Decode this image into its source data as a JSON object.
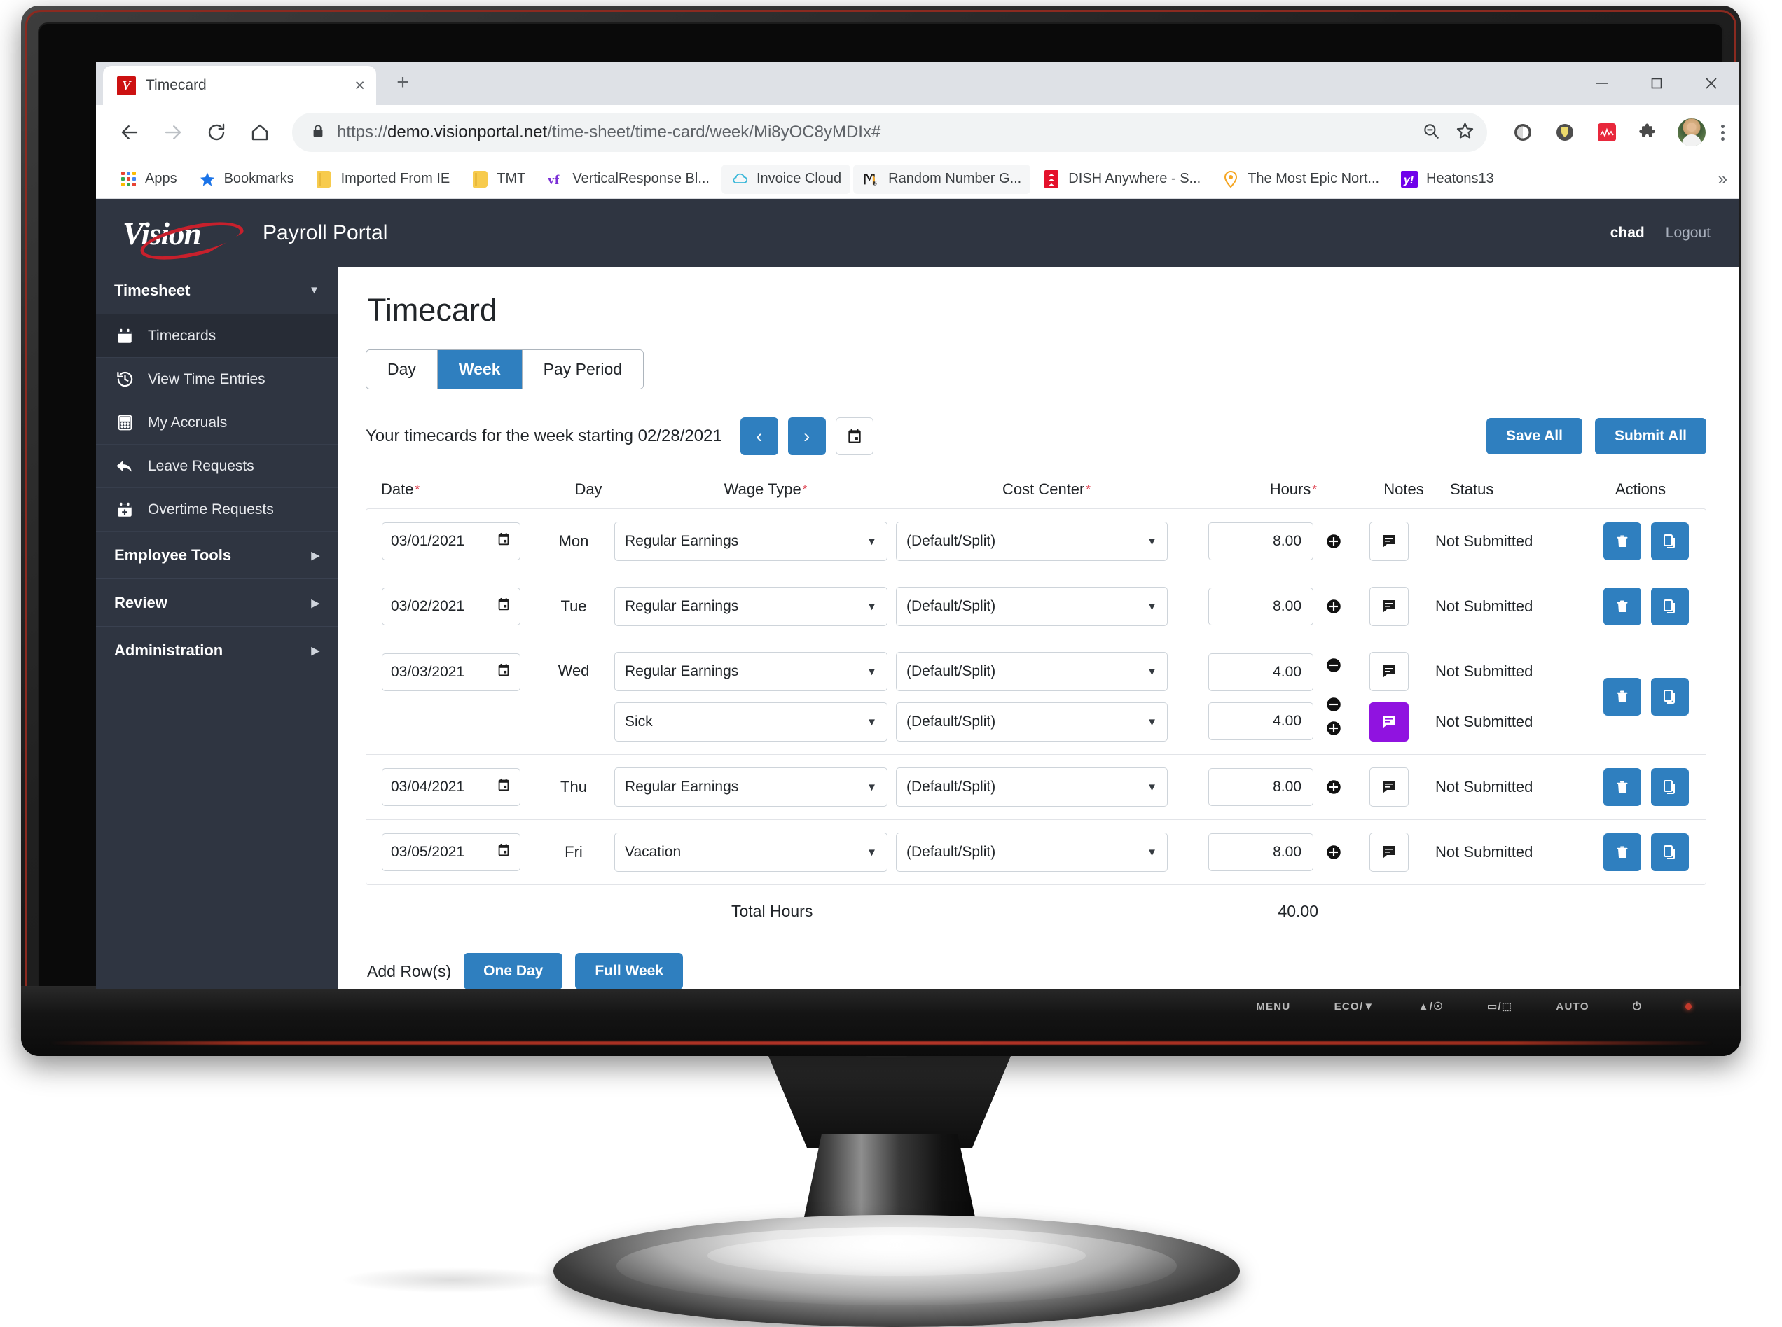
{
  "browser": {
    "tab": {
      "title": "Timecard",
      "favicon": "vision-v-icon",
      "close_label": "×"
    },
    "new_tab_label": "+",
    "window_controls": {
      "minimize": "minimize-icon",
      "maximize": "maximize-icon",
      "close": "close-icon"
    },
    "nav": {
      "back": "back-arrow-icon",
      "forward": "forward-arrow-icon",
      "reload": "reload-icon",
      "home": "home-icon"
    },
    "omnibox": {
      "lock": "lock-icon",
      "url_scheme": "https://",
      "url_domain": "demo.visionportal.net",
      "url_path": "/time-sheet/time-card/week/Mi8yOC8yMDIx#",
      "zoom_icon": "zoom-out-icon",
      "bookmark_icon": "star-icon"
    },
    "extensions": [
      "circle-extension-icon",
      "shield-extension-icon",
      "red-chart-extension-icon",
      "puzzle-extensions-icon"
    ],
    "profile": "profile-avatar",
    "menu": "three-dot-menu-icon",
    "bookmarks": [
      {
        "label": "Apps",
        "icon": "apps-grid-icon"
      },
      {
        "label": "Bookmarks",
        "icon": "star-icon"
      },
      {
        "label": "Imported From IE",
        "icon": "folder-icon"
      },
      {
        "label": "TMT",
        "icon": "folder-icon"
      },
      {
        "label": "VerticalResponse Bl...",
        "icon": "vr-icon"
      },
      {
        "label": "Invoice Cloud",
        "icon": "cloud-icon"
      },
      {
        "label": "Random Number G...",
        "icon": "ms-icon"
      },
      {
        "label": "DISH Anywhere - S...",
        "icon": "dish-icon"
      },
      {
        "label": "The Most Epic Nort...",
        "icon": "pin-icon"
      },
      {
        "label": "Heatons13",
        "icon": "yahoo-icon"
      }
    ],
    "bookmarks_overflow": "»"
  },
  "app_header": {
    "logo_word": "Vision",
    "subtitle": "Payroll Portal",
    "user": "chad",
    "logout": "Logout"
  },
  "sidebar": {
    "groups": [
      {
        "label": "Timesheet",
        "expanded": true,
        "caret": "chevron-down-icon",
        "items": [
          {
            "label": "Timecards",
            "icon": "calendar-icon",
            "active": true
          },
          {
            "label": "View Time Entries",
            "icon": "history-icon",
            "active": false
          },
          {
            "label": "My Accruals",
            "icon": "calculator-icon",
            "active": false
          },
          {
            "label": "Leave Requests",
            "icon": "reply-arrow-icon",
            "active": false
          },
          {
            "label": "Overtime Requests",
            "icon": "calendar-plus-icon",
            "active": false
          }
        ]
      },
      {
        "label": "Employee Tools",
        "expanded": false,
        "caret": "chevron-right-icon",
        "items": []
      },
      {
        "label": "Review",
        "expanded": false,
        "caret": "chevron-right-icon",
        "items": []
      },
      {
        "label": "Administration",
        "expanded": false,
        "caret": "chevron-right-icon",
        "items": []
      }
    ]
  },
  "main": {
    "title": "Timecard",
    "view_tabs": [
      {
        "label": "Day",
        "active": false
      },
      {
        "label": "Week",
        "active": true
      },
      {
        "label": "Pay Period",
        "active": false
      }
    ],
    "week_text": "Your timecards for the week starting 02/28/2021",
    "prev_icon": "chevron-left-icon",
    "next_icon": "chevron-right-icon",
    "calendar_icon": "calendar-picker-icon",
    "save_all": "Save All",
    "submit_all": "Submit All",
    "columns": {
      "date": "Date",
      "day": "Day",
      "wage_type": "Wage Type",
      "cost_center": "Cost Center",
      "hours": "Hours",
      "notes": "Notes",
      "status": "Status",
      "actions": "Actions"
    },
    "required_mark": "*",
    "rows": [
      {
        "date": "03/01/2021",
        "day": "Mon",
        "entries": [
          {
            "wage_type": "Regular Earnings",
            "cost_center": "(Default/Split)",
            "hours": "8.00",
            "plusminus": [
              "plus-icon"
            ],
            "note_icon": "note-icon",
            "note_highlight": false,
            "status": "Not Submitted"
          }
        ],
        "actions": [
          "delete-icon",
          "copy-icon"
        ]
      },
      {
        "date": "03/02/2021",
        "day": "Tue",
        "entries": [
          {
            "wage_type": "Regular Earnings",
            "cost_center": "(Default/Split)",
            "hours": "8.00",
            "plusminus": [
              "plus-icon"
            ],
            "note_icon": "note-icon",
            "note_highlight": false,
            "status": "Not Submitted"
          }
        ],
        "actions": [
          "delete-icon",
          "copy-icon"
        ]
      },
      {
        "date": "03/03/2021",
        "day": "Wed",
        "entries": [
          {
            "wage_type": "Regular Earnings",
            "cost_center": "(Default/Split)",
            "hours": "4.00",
            "plusminus": [
              "minus-icon"
            ],
            "note_icon": "note-icon",
            "note_highlight": false,
            "status": "Not Submitted"
          },
          {
            "wage_type": "Sick",
            "cost_center": "(Default/Split)",
            "hours": "4.00",
            "plusminus": [
              "minus-icon",
              "plus-icon"
            ],
            "note_icon": "note-icon",
            "note_highlight": true,
            "status": "Not Submitted"
          }
        ],
        "actions": [
          "delete-icon",
          "copy-icon"
        ]
      },
      {
        "date": "03/04/2021",
        "day": "Thu",
        "entries": [
          {
            "wage_type": "Regular Earnings",
            "cost_center": "(Default/Split)",
            "hours": "8.00",
            "plusminus": [
              "plus-icon"
            ],
            "note_icon": "note-icon",
            "note_highlight": false,
            "status": "Not Submitted"
          }
        ],
        "actions": [
          "delete-icon",
          "copy-icon"
        ]
      },
      {
        "date": "03/05/2021",
        "day": "Fri",
        "entries": [
          {
            "wage_type": "Vacation",
            "cost_center": "(Default/Split)",
            "hours": "8.00",
            "plusminus": [
              "plus-icon"
            ],
            "note_icon": "note-icon",
            "note_highlight": false,
            "status": "Not Submitted"
          }
        ],
        "actions": [
          "delete-icon",
          "copy-icon"
        ]
      }
    ],
    "total_label": "Total Hours",
    "total_value": "40.00",
    "add_rows_label": "Add Row(s)",
    "add_one_day": "One Day",
    "add_full_week": "Full Week"
  },
  "monitor": {
    "osd": [
      "MENU",
      "ECO/▼",
      "▲/☉",
      "▭/⬚",
      "AUTO",
      "⏻"
    ]
  },
  "colors": {
    "accent_blue": "#2f7fbf",
    "sidebar_dark": "#2f3541",
    "note_highlight_purple": "#9013e0",
    "required_red": "#dc3545",
    "logo_red": "#c8202c"
  }
}
